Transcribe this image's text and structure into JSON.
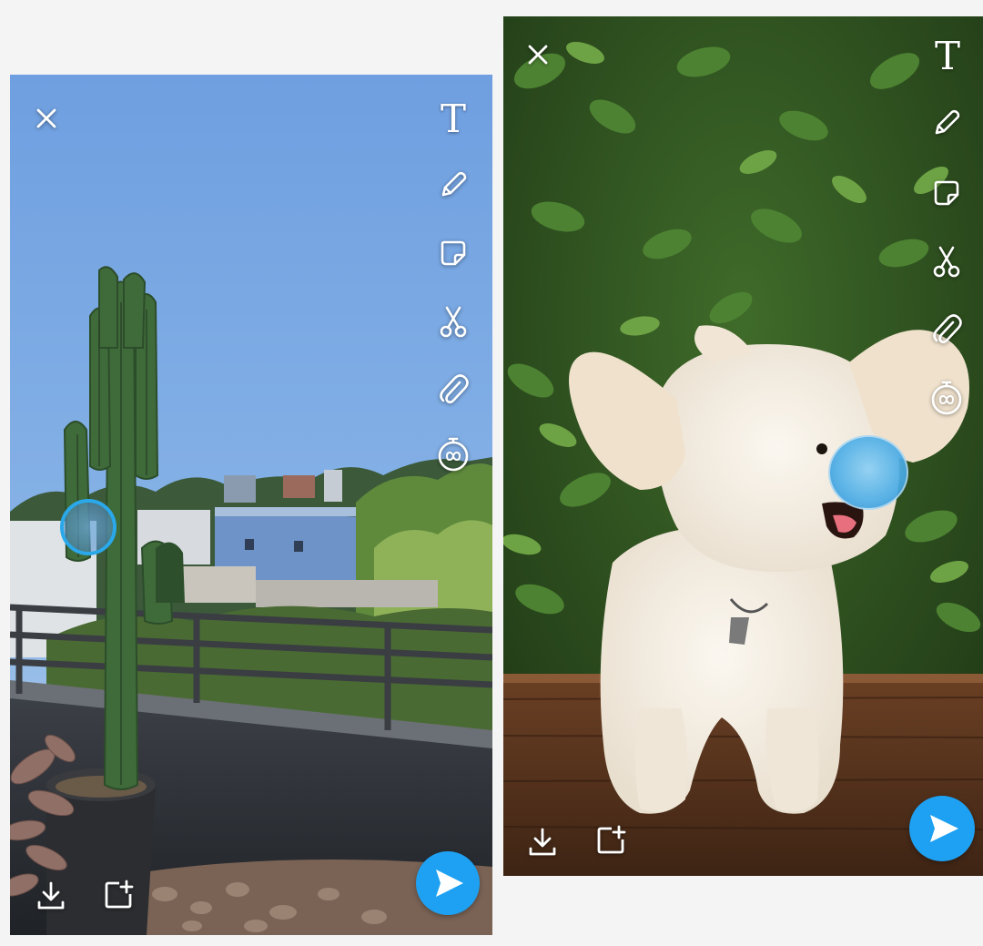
{
  "colors": {
    "accent": "#1ea1f2",
    "send_button": "#1ea1f2",
    "ring": "#2aa8ea",
    "icon": "#ffffff",
    "page_background": "#f4f4f4"
  },
  "screens": [
    {
      "name": "balcony-cactus-snap",
      "top_left_icon": "close-icon",
      "toolbar": [
        {
          "icon": "text-icon",
          "glyph": "T"
        },
        {
          "icon": "pencil-icon"
        },
        {
          "icon": "sticker-icon"
        },
        {
          "icon": "scissors-icon"
        },
        {
          "icon": "paperclip-icon"
        },
        {
          "icon": "timer-infinity-icon"
        }
      ],
      "bottom_actions": [
        "download-icon",
        "add-to-story-icon"
      ],
      "send_icon": "send-arrow-icon",
      "drag_target": "blue-ring-lens"
    },
    {
      "name": "dog-snap",
      "top_left_icon": "close-icon",
      "toolbar": [
        {
          "icon": "text-icon",
          "glyph": "T"
        },
        {
          "icon": "pencil-icon"
        },
        {
          "icon": "sticker-icon"
        },
        {
          "icon": "scissors-icon"
        },
        {
          "icon": "paperclip-icon"
        },
        {
          "icon": "timer-infinity-icon"
        }
      ],
      "bottom_actions": [
        "download-icon",
        "add-to-story-icon"
      ],
      "send_icon": "send-arrow-icon",
      "drag_target": "blue-ring-lens"
    }
  ]
}
